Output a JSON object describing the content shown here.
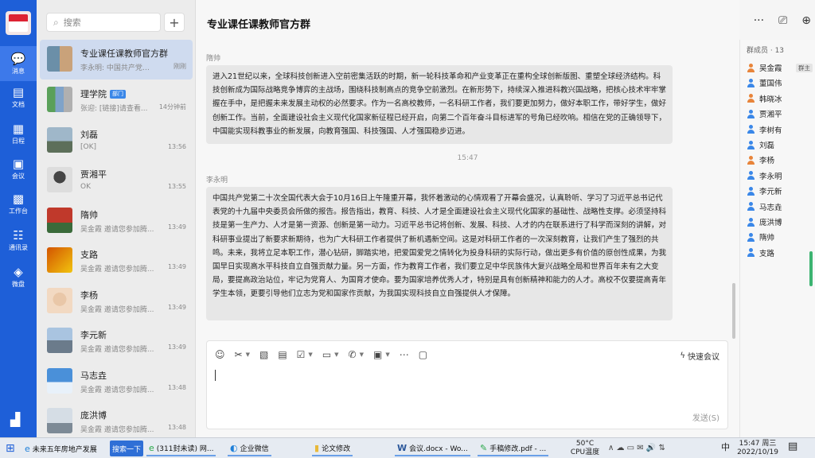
{
  "rail": {
    "items": [
      {
        "icon": "💬",
        "label": "消息"
      },
      {
        "icon": "▤",
        "label": "文档"
      },
      {
        "icon": "▦",
        "label": "日程"
      },
      {
        "icon": "▣",
        "label": "会议"
      },
      {
        "icon": "▩",
        "label": "工作台"
      },
      {
        "icon": "☷",
        "label": "通讯录"
      },
      {
        "icon": "◈",
        "label": "微盘"
      }
    ],
    "bottom_icon": "▟"
  },
  "search": {
    "placeholder": "搜索",
    "add_label": "+"
  },
  "conversations": [
    {
      "name": "专业课任课教师官方群",
      "preview": "李永明: 中国共产党第...",
      "time": "刚刚",
      "tag": ""
    },
    {
      "name": "理学院",
      "preview": "张迎: [链接]请查看...",
      "time": "14分钟前",
      "tag": "部门"
    },
    {
      "name": "刘磊",
      "preview": "[OK]",
      "time": "13:56",
      "tag": ""
    },
    {
      "name": "贾湘平",
      "preview": "OK",
      "time": "13:55",
      "tag": ""
    },
    {
      "name": "隋帅",
      "preview": "吴金霞 邀请您参加腾...",
      "time": "13:49",
      "tag": ""
    },
    {
      "name": "支路",
      "preview": "吴金霞 邀请您参加腾...",
      "time": "13:49",
      "tag": ""
    },
    {
      "name": "李杨",
      "preview": "吴金霞 邀请您参加腾...",
      "time": "13:49",
      "tag": ""
    },
    {
      "name": "李元新",
      "preview": "吴金霞 邀请您参加腾...",
      "time": "13:49",
      "tag": ""
    },
    {
      "name": "马志垚",
      "preview": "吴金霞 邀请您参加腾...",
      "time": "13:48",
      "tag": ""
    },
    {
      "name": "庞洪博",
      "preview": "吴金霞 邀请您参加腾...",
      "time": "13:48",
      "tag": ""
    }
  ],
  "chat": {
    "title": "专业课任课教师官方群",
    "actions": [
      "···",
      "⎚",
      "⊕"
    ],
    "messages": [
      {
        "sender": "隋帅",
        "text": "进入21世纪以来，全球科技创新进入空前密集活跃的时期，新一轮科技革命和产业变革正在重构全球创新版图、重塑全球经济结构。科技创新成为国际战略竞争博弈的主战场，围绕科技制高点的竞争空前激烈。在新形势下，持续深入推进科教兴国战略，把核心技术牢牢掌握在手中，是把握未来发展主动权的必然要求。作为一名高校教师，一名科研工作者，我们要更加努力，做好本职工作，带好学生，做好创新工作。当前，全面建设社会主义现代化国家新征程已经开启，向第二个百年奋斗目标进军的号角已经吹响。相信在党的正确领导下，中国能实现科教事业的新发展，向教育强国、科技强国、人才强国稳步迈进。"
      },
      {
        "sender": "李永明",
        "text": "中国共产党第二十次全国代表大会于10月16日上午隆重开幕，我怀着激动的心情观看了开幕会盛况，认真聆听、学习了习近平总书记代表党的十九届中央委员会所做的报告。报告指出，教育、科技、人才是全面建设社会主义现代化国家的基础性、战略性支撑。必须坚持科技是第一生产力、人才是第一资源、创新是第一动力。习近平总书记将创新、发展、科技、人才的内在联系进行了科学而深刻的讲解，对科研事业提出了新要求新期待，也为广大科研工作者提供了新机遇新空间。这是对科研工作者的一次深刻教育，让我们产生了强烈的共鸣。未来，我将立足本职工作，潜心钻研，脚踏实地，把爱国爱党之情转化为投身科研的实际行动，做出更多有价值的原创性成果，为我国早日实现高水平科技自立自强贡献力量。另一方面，作为教育工作者，我们要立足中华民族伟大复兴战略全局和世界百年未有之大变局，要提高政治站位，牢记为党育人、为国育才使命。要为国家培养优秀人才，特别是具有创新精神和能力的人才。高校不仅要提高青年学生本领，更要引导他们立志为党和国家作贡献，为我国实现科技自立自强提供人才保障。"
      }
    ],
    "timestamp": "15:47"
  },
  "composer": {
    "tools": [
      "☺",
      "✂",
      "▧",
      "▤",
      "☑",
      "▭",
      "✆",
      "▣",
      "⋯",
      "▢"
    ],
    "quick_meeting": "快速会议",
    "quick_icon": "ϟ",
    "send_label": "发送(S)"
  },
  "members": {
    "header": "群成员 · 13",
    "owner_tag": "群主",
    "list": [
      {
        "name": "吴金霞",
        "color": "#e8843a"
      },
      {
        "name": "董国伟",
        "color": "#3a87e8"
      },
      {
        "name": "韩晓冰",
        "color": "#e8843a"
      },
      {
        "name": "贾湘平",
        "color": "#3a87e8"
      },
      {
        "name": "李树有",
        "color": "#3a87e8"
      },
      {
        "name": "刘磊",
        "color": "#3a87e8"
      },
      {
        "name": "李杨",
        "color": "#e8843a"
      },
      {
        "name": "李永明",
        "color": "#3a87e8"
      },
      {
        "name": "李元新",
        "color": "#3a87e8"
      },
      {
        "name": "马志垚",
        "color": "#3a87e8"
      },
      {
        "name": "庞洪博",
        "color": "#3a87e8"
      },
      {
        "name": "隋帅",
        "color": "#3a87e8"
      },
      {
        "name": "支路",
        "color": "#3a87e8"
      }
    ]
  },
  "taskbar": {
    "start_icon": "⊞",
    "items": [
      {
        "icon": "e",
        "label": "未来五年房地产发展",
        "style": "plain"
      },
      {
        "icon": "",
        "label": "搜索一下",
        "style": "btn"
      },
      {
        "icon": "e",
        "label": "(311封未读) 网...",
        "style": "app"
      },
      {
        "icon": "◐",
        "label": "企业微信",
        "style": "app"
      },
      {
        "icon": "▮",
        "label": "论文修改",
        "style": "app"
      },
      {
        "icon": "W",
        "label": "会议.docx - Wo...",
        "style": "app"
      },
      {
        "icon": "✎",
        "label": "手稿修改.pdf - ...",
        "style": "app"
      }
    ],
    "temp": "50°C",
    "temp_label": "CPU温度",
    "tray_icons": "∧ ☁ ▭ ✉ 🔊 ⇅",
    "ime": "中",
    "time": "15:47 周三",
    "date": "2022/10/19",
    "notify_icon": "▤"
  }
}
